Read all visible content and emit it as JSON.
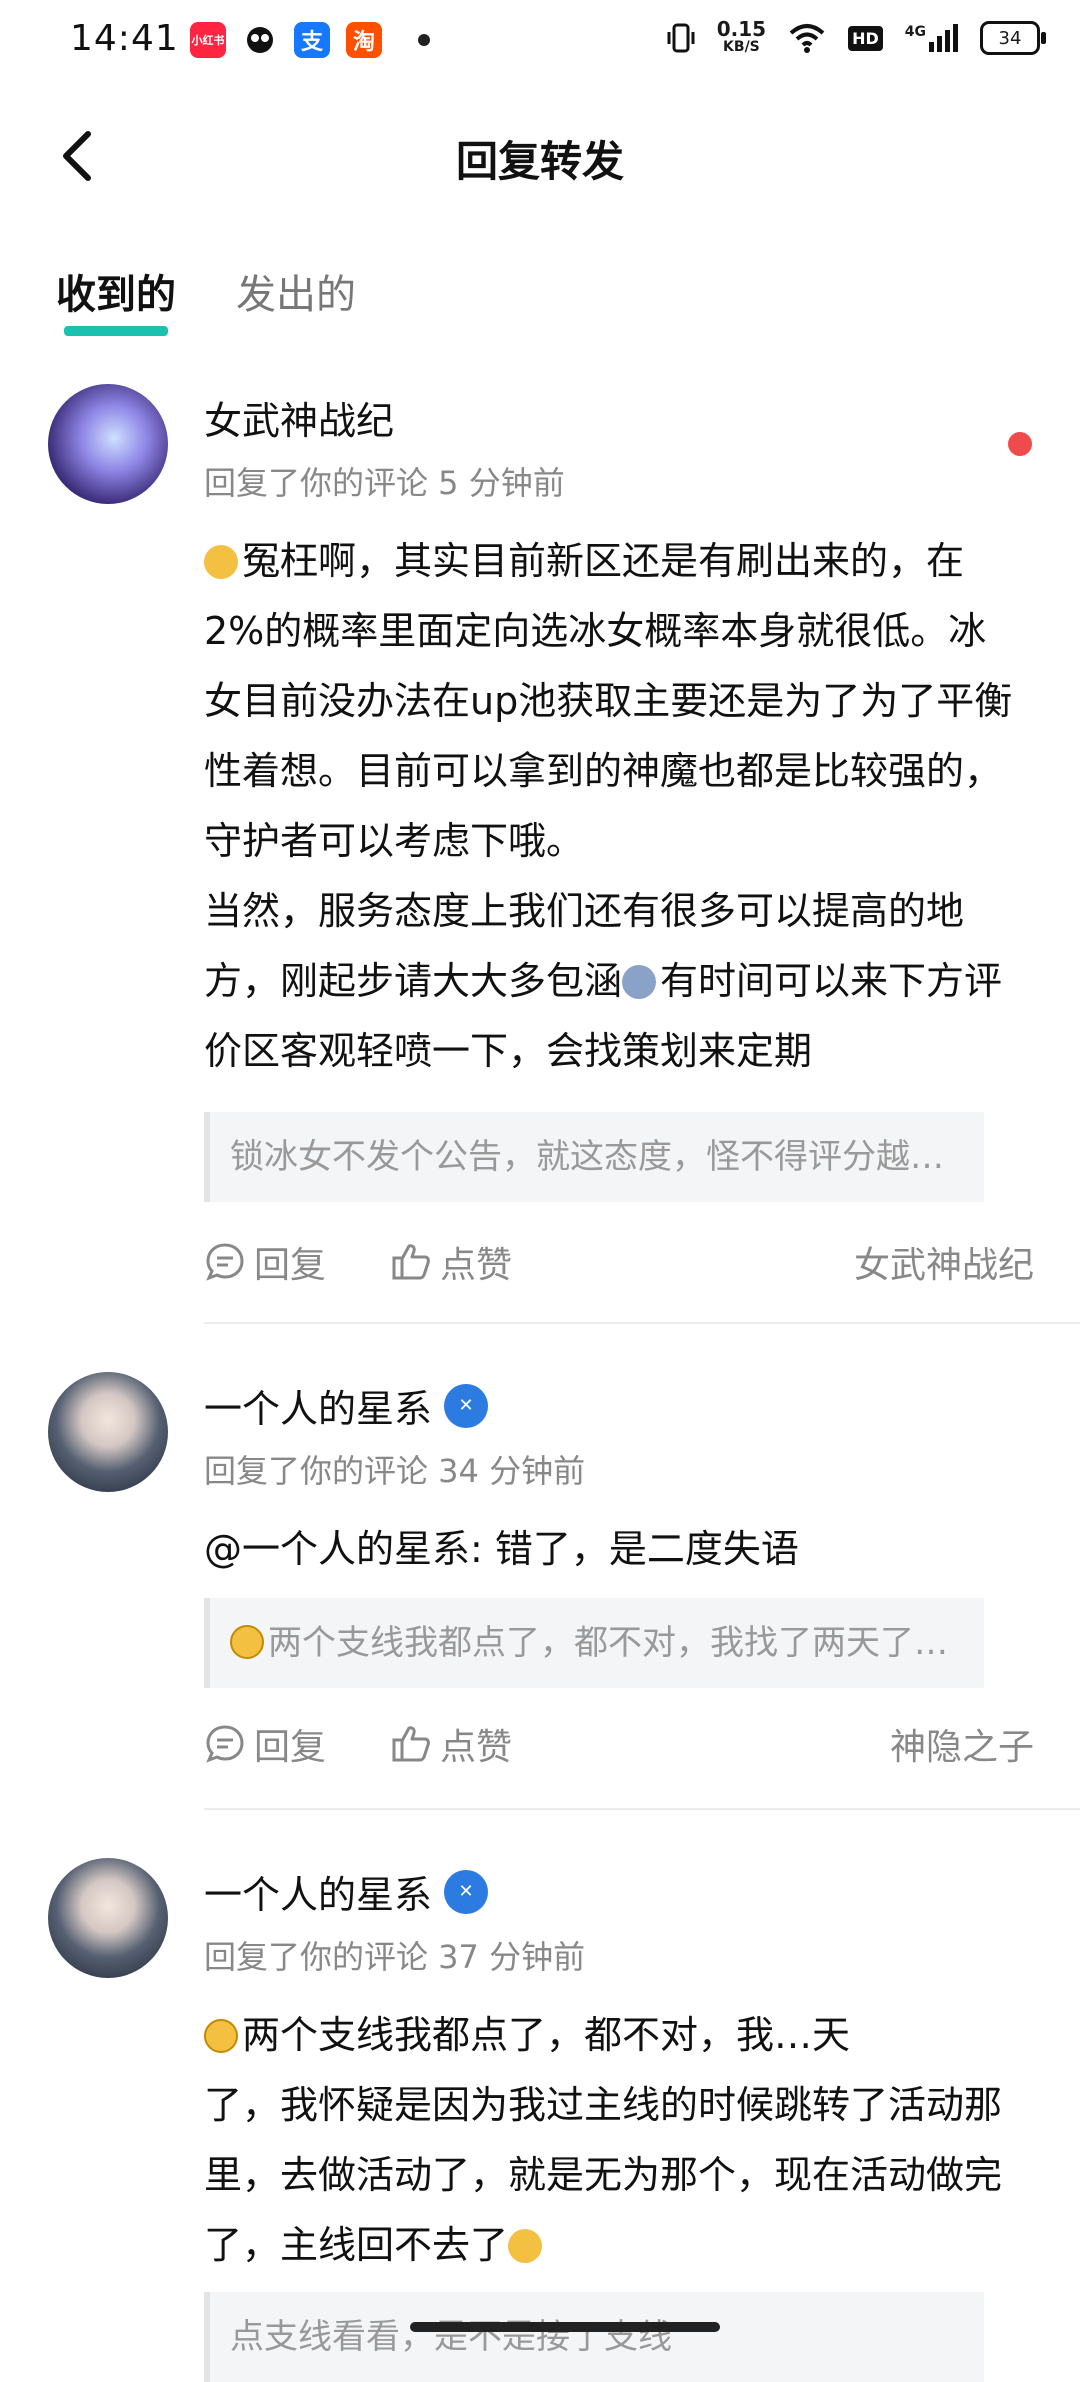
{
  "status": {
    "time": "14:41",
    "app_icons": [
      {
        "name": "xiaohongshu",
        "text": "小红书",
        "color": "#ff2442"
      },
      {
        "name": "panda-app",
        "text": "",
        "color": "#111111"
      },
      {
        "name": "alipay",
        "text": "支",
        "color": "#1677ff"
      },
      {
        "name": "taobao",
        "text": "淘",
        "color": "#ff5000"
      }
    ],
    "network_speed_value": "0.15",
    "network_speed_unit": "KB/S",
    "hd": "HD",
    "signal": "4G",
    "battery": "34"
  },
  "header": {
    "title": "回复转发"
  },
  "tabs": [
    {
      "label": "收到的",
      "active": true
    },
    {
      "label": "发出的",
      "active": false
    }
  ],
  "items": [
    {
      "name": "女武神战纪",
      "meta": "回复了你的评论 5 分钟前",
      "verified": false,
      "unread": true,
      "content": {
        "p1_rest": "冤枉啊，其实目前新区还是有刷出来的，在2%的概率里面定向选冰女概率本身就很低。冰女目前没办法在up池获取主要还是为了为了平衡性着想。目前可以拿到的神魔也都是比较强的，守护者可以考虑下哦。",
        "p2_before": "当然，服务态度上我们还有很多可以提高的地方，刚起步请大大多包涵",
        "p2_after": "有时间可以来下方评价区客观轻喷一下，会找策划来定期"
      },
      "quote": "锁冰女不发个公告，就这态度，怪不得评分越…",
      "reply_label": "回复",
      "like_label": "点赞",
      "source": "女武神战纪"
    },
    {
      "name": "一个人的星系",
      "meta": "回复了你的评论 34 分钟前",
      "verified": true,
      "content": {
        "text": "@一个人的星系: 错了，是二度失语"
      },
      "quote": "两个支线我都点了，都不对，我找了两天了…",
      "reply_label": "回复",
      "like_label": "点赞",
      "source": "神隐之子"
    },
    {
      "name": "一个人的星系",
      "meta": "回复了你的评论 37 分钟前",
      "verified": true,
      "content": {
        "line1": "两个支线我都点了，都不对，我…天",
        "rest": "了，我怀疑是因为我过主线的时候跳转了活动那里，去做活动了，就是无为那个，现在活动做完了，主线回不去了"
      },
      "quote": "点支线看看，是不是接了支线"
    }
  ],
  "colors": {
    "accent": "#19c1ae",
    "unread_dot": "#ef4b4b",
    "badge": "#2b7be0"
  }
}
